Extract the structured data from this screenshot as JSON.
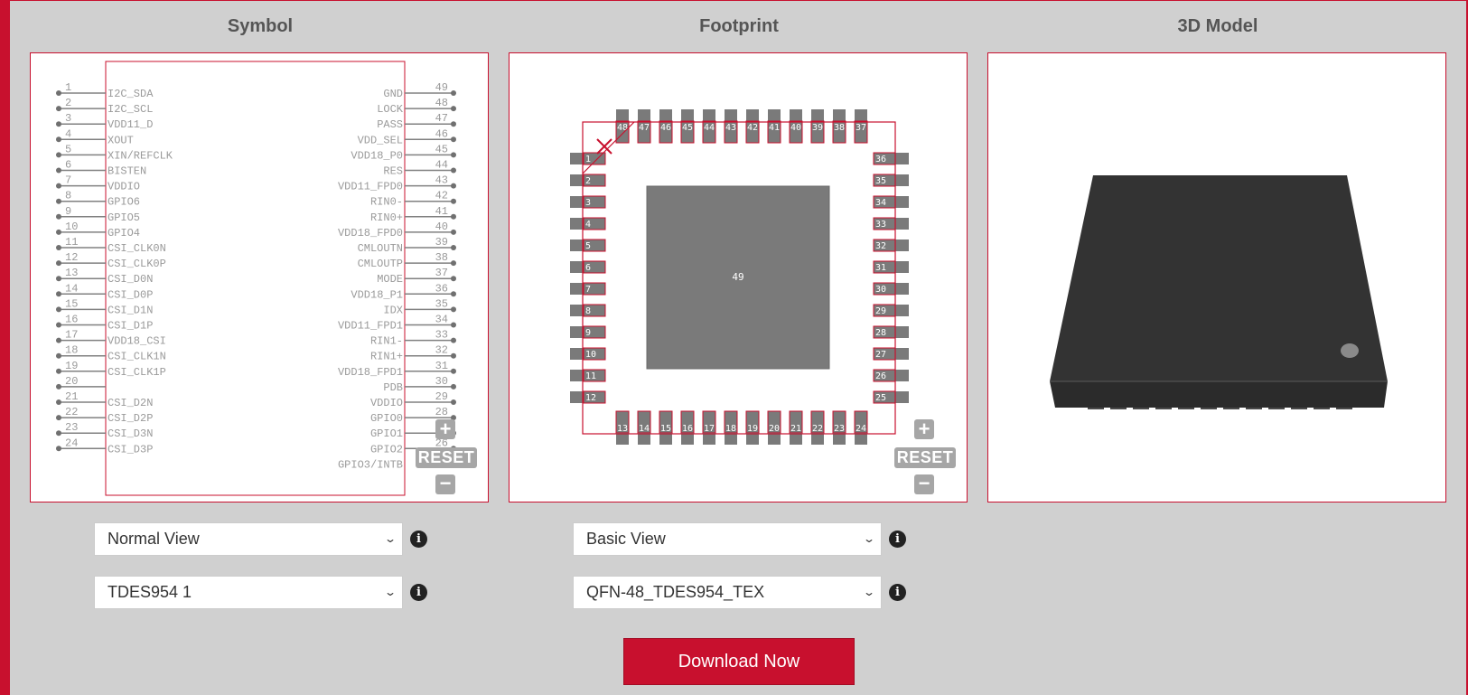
{
  "headers": {
    "symbol": "Symbol",
    "footprint": "Footprint",
    "model": "3D Model"
  },
  "symbol": {
    "pin_numbers_left": [
      "1",
      "2",
      "3",
      "4",
      "5",
      "6",
      "7",
      "8",
      "9",
      "10",
      "11",
      "12",
      "13",
      "14",
      "15",
      "16",
      "17",
      "18",
      "19",
      "20",
      "21",
      "22",
      "23",
      "24"
    ],
    "pin_names_left": [
      "I2C_SDA",
      "I2C_SCL",
      "VDD11_D",
      "XOUT",
      "XIN/REFCLK",
      "BISTEN",
      "VDDIO",
      "GPIO6",
      "GPIO5",
      "GPIO4",
      "CSI_CLK0N",
      "CSI_CLK0P",
      "CSI_D0N",
      "CSI_D0P",
      "CSI_D1N",
      "CSI_D1P",
      "VDD18_CSI",
      "CSI_CLK1N",
      "CSI_CLK1P",
      "",
      "CSI_D2N",
      "CSI_D2P",
      "CSI_D3N",
      "CSI_D3P"
    ],
    "pin_numbers_right": [
      "49",
      "48",
      "47",
      "46",
      "45",
      "44",
      "43",
      "42",
      "41",
      "40",
      "39",
      "38",
      "37",
      "36",
      "35",
      "34",
      "33",
      "32",
      "31",
      "30",
      "29",
      "28",
      "27",
      "26"
    ],
    "pin_names_right": [
      "GND",
      "LOCK",
      "PASS",
      "VDD_SEL",
      "VDD18_P0",
      "RES",
      "VDD11_FPD0",
      "RIN0-",
      "RIN0+",
      "VDD18_FPD0",
      "CMLOUTN",
      "CMLOUTP",
      "MODE",
      "VDD18_P1",
      "IDX",
      "VDD11_FPD1",
      "RIN1-",
      "RIN1+",
      "VDD18_FPD1",
      "PDB",
      "VDDIO",
      "GPIO0",
      "GPIO1",
      "GPIO2",
      "GPIO3/INTB"
    ]
  },
  "footprint": {
    "top_pins": [
      "48",
      "47",
      "46",
      "45",
      "44",
      "43",
      "42",
      "41",
      "40",
      "39",
      "38",
      "37"
    ],
    "left_pins": [
      "1",
      "2",
      "3",
      "4",
      "5",
      "6",
      "7",
      "8",
      "9",
      "10",
      "11",
      "12"
    ],
    "right_pins": [
      "36",
      "35",
      "34",
      "33",
      "32",
      "31",
      "30",
      "29",
      "28",
      "27",
      "26",
      "25"
    ],
    "bottom_pins": [
      "13",
      "14",
      "15",
      "16",
      "17",
      "18",
      "19",
      "20",
      "21",
      "22",
      "23",
      "24"
    ],
    "center_pad": "49"
  },
  "zoom": {
    "plus": "+",
    "reset": "RESET",
    "minus": "−"
  },
  "controls": {
    "symbol_view": "Normal View",
    "symbol_part": "TDES954 1",
    "footprint_view": "Basic View",
    "footprint_package": "QFN-48_TDES954_TEX"
  },
  "download_label": "Download Now",
  "colors": {
    "brand_red": "#c8102e",
    "pad_gray": "#7a7a7a",
    "body_dark": "#333333"
  }
}
